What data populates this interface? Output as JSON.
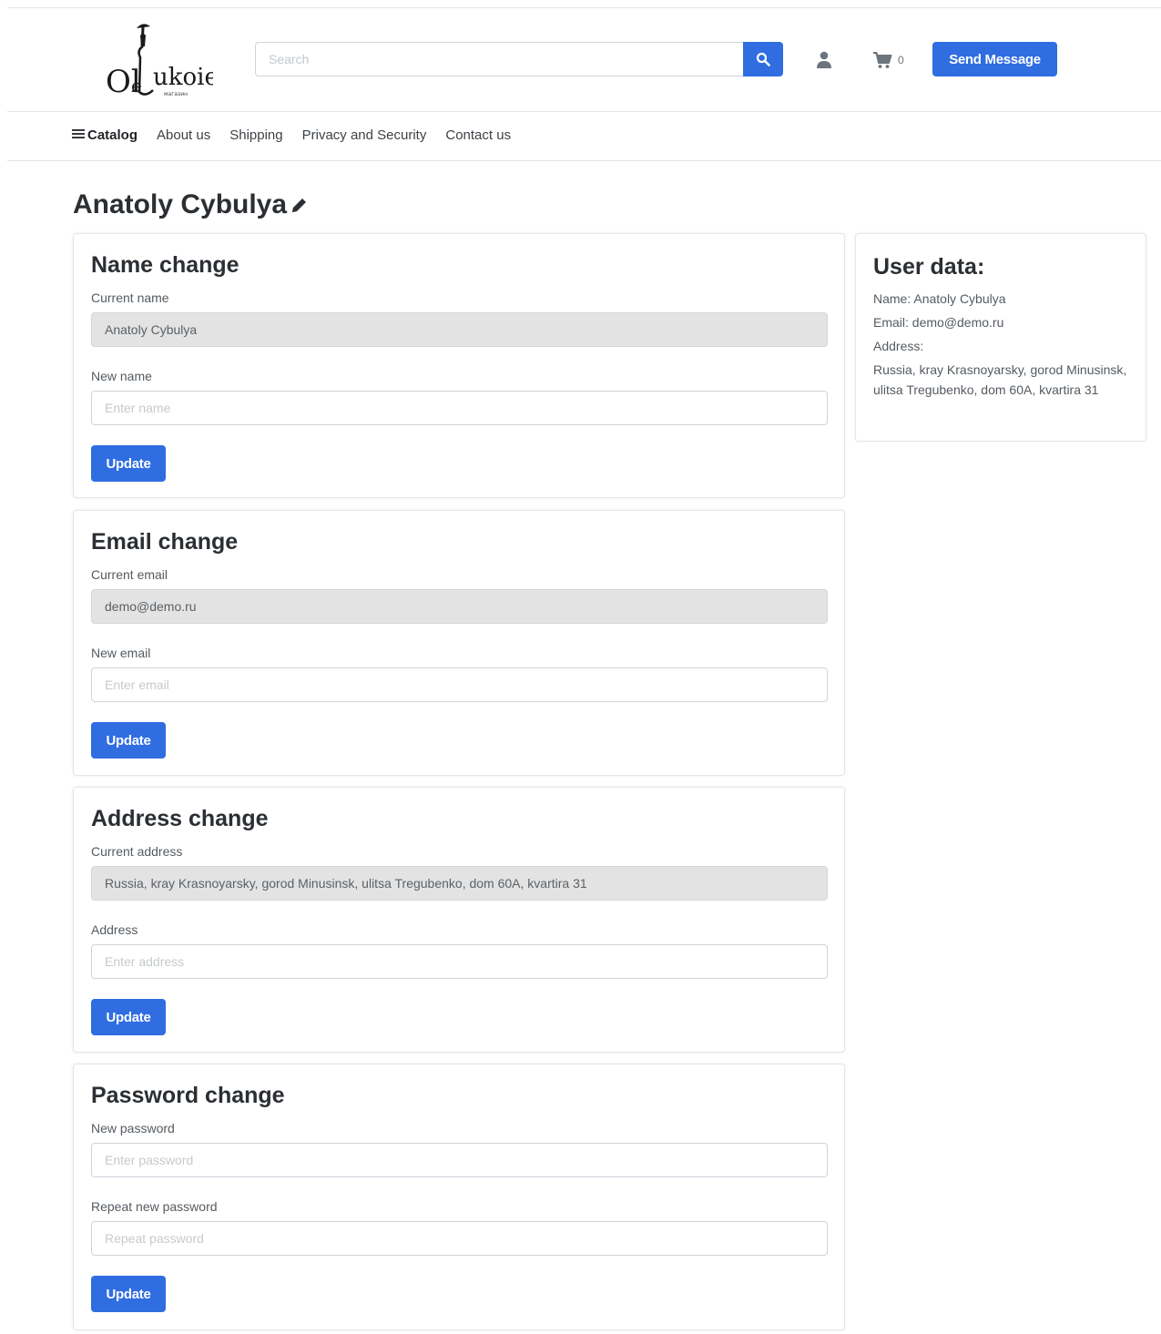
{
  "header": {
    "logo_text": "Ole Lukoie",
    "search_placeholder": "Search",
    "cart_count": "0",
    "send_message_label": "Send Message"
  },
  "nav": {
    "catalog": "Catalog",
    "items": [
      "About us",
      "Shipping",
      "Privacy and Security",
      "Contact us"
    ]
  },
  "page_title": "Anatoly Cybulya",
  "name_change": {
    "title": "Name change",
    "current_label": "Current name",
    "current_value": "Anatoly Cybulya",
    "new_label": "New name",
    "new_placeholder": "Enter name",
    "button": "Update"
  },
  "email_change": {
    "title": "Email change",
    "current_label": "Current email",
    "current_value": "demo@demo.ru",
    "new_label": "New email",
    "new_placeholder": "Enter email",
    "button": "Update"
  },
  "address_change": {
    "title": "Address change",
    "current_label": "Current address",
    "current_value": "Russia, kray Krasnoyarsky, gorod Minusinsk, ulitsa Tregubenko, dom 60A, kvartira 31",
    "new_label": "Address",
    "new_placeholder": "Enter address",
    "button": "Update"
  },
  "password_change": {
    "title": "Password change",
    "new_label": "New password",
    "new_placeholder": "Enter password",
    "repeat_label": "Repeat new password",
    "repeat_placeholder": "Repeat password",
    "button": "Update"
  },
  "user_data": {
    "title": "User data:",
    "name_line": "Name: Anatoly Cybulya",
    "email_line": "Email: demo@demo.ru",
    "address_label": "Address:",
    "address_value": "Russia, kray Krasnoyarsky, gorod Minusinsk, ulitsa Tregubenko, dom 60A, kvartira 31"
  },
  "colors": {
    "primary": "#2f6de1",
    "readonly_bg": "#e3e3e3"
  },
  "icons": {
    "search": "search-icon",
    "user": "user-icon",
    "cart": "cart-icon",
    "menu": "menu-icon",
    "edit": "pencil-icon"
  }
}
